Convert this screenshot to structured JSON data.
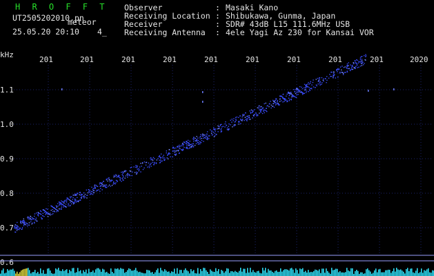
{
  "header": {
    "title": "H R O F F T",
    "filename": "UT2505202010.pn",
    "filename_suffix": "meteor",
    "datetime": "25.05.20 20:10",
    "count": "4_",
    "rows": [
      {
        "label": "Observer",
        "sep": ":",
        "value": "Masaki Kano"
      },
      {
        "label": "Receiving Location",
        "sep": ":",
        "value": "Shibukawa, Gunma, Japan"
      },
      {
        "label": "Receiver",
        "sep": ":",
        "value": "SDR# 43dB L15 111.6MHz USB"
      },
      {
        "label": "Receiving Antenna",
        "sep": ":",
        "value": "4ele Yagi Az 230 for Kansai VOR"
      }
    ]
  },
  "axes": {
    "y_unit": "kHz",
    "y_ticks": [
      "1.1",
      "1.0",
      "0.9",
      "0.8",
      "0.7",
      "0.6"
    ],
    "year_labels": [
      "201",
      "201",
      "201",
      "201",
      "201",
      "201",
      "201",
      "201",
      "201",
      "2020"
    ]
  },
  "chart_data": {
    "type": "scatter",
    "title": "",
    "ylabel": "kHz",
    "ylim": [
      0.6,
      1.2
    ],
    "trend": {
      "start": 0.7,
      "end": 1.19
    },
    "grid": true,
    "colors": {
      "points": "#3a4cff",
      "grid": "#1d2370",
      "baseline": "#9aa0ff",
      "spectrum": "#30e6ff"
    }
  }
}
